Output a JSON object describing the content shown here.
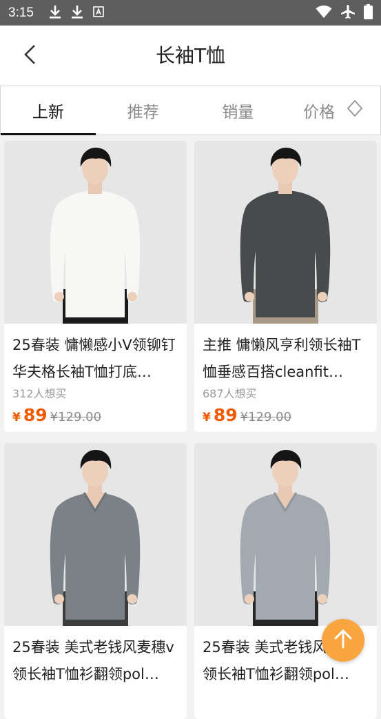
{
  "status": {
    "time": "3:15"
  },
  "header": {
    "title": "长袖T恤"
  },
  "tabs": [
    {
      "label": "上新",
      "active": true
    },
    {
      "label": "推荐",
      "active": false
    },
    {
      "label": "销量",
      "active": false
    },
    {
      "label": "价格",
      "active": false
    }
  ],
  "products": [
    {
      "title": "25春装 慵懒感小V领铆钉华夫格长袖T恤打底…",
      "want": "312人想买",
      "currency": "¥",
      "price": "89",
      "original_price": "¥129.00",
      "shirt_color": "#f7f7f5"
    },
    {
      "title": "主推 慵懒风亨利领长袖T恤垂感百搭cleanfit…",
      "want": "687人想买",
      "currency": "¥",
      "price": "89",
      "original_price": "¥129.00",
      "shirt_color": "#474b4c"
    },
    {
      "title": "25春装 美式老钱风麦穗v领长袖T恤衫翻领pol…",
      "currency": "¥",
      "shirt_color": "#7a8187"
    },
    {
      "title": "25春装 美式老钱风麦穗v领长袖T恤衫翻领pol…",
      "currency": "¥",
      "shirt_color": "#a3a9b0"
    }
  ],
  "colors": {
    "accent": "#f15a00",
    "fab": "#f9a640",
    "status_bar": "#5e5e5e"
  },
  "icons": [
    "download-icon",
    "download-icon",
    "text-icon",
    "wifi-icon",
    "airplane-icon",
    "battery-icon",
    "back-icon",
    "sort-icon",
    "arrow-up-icon"
  ]
}
